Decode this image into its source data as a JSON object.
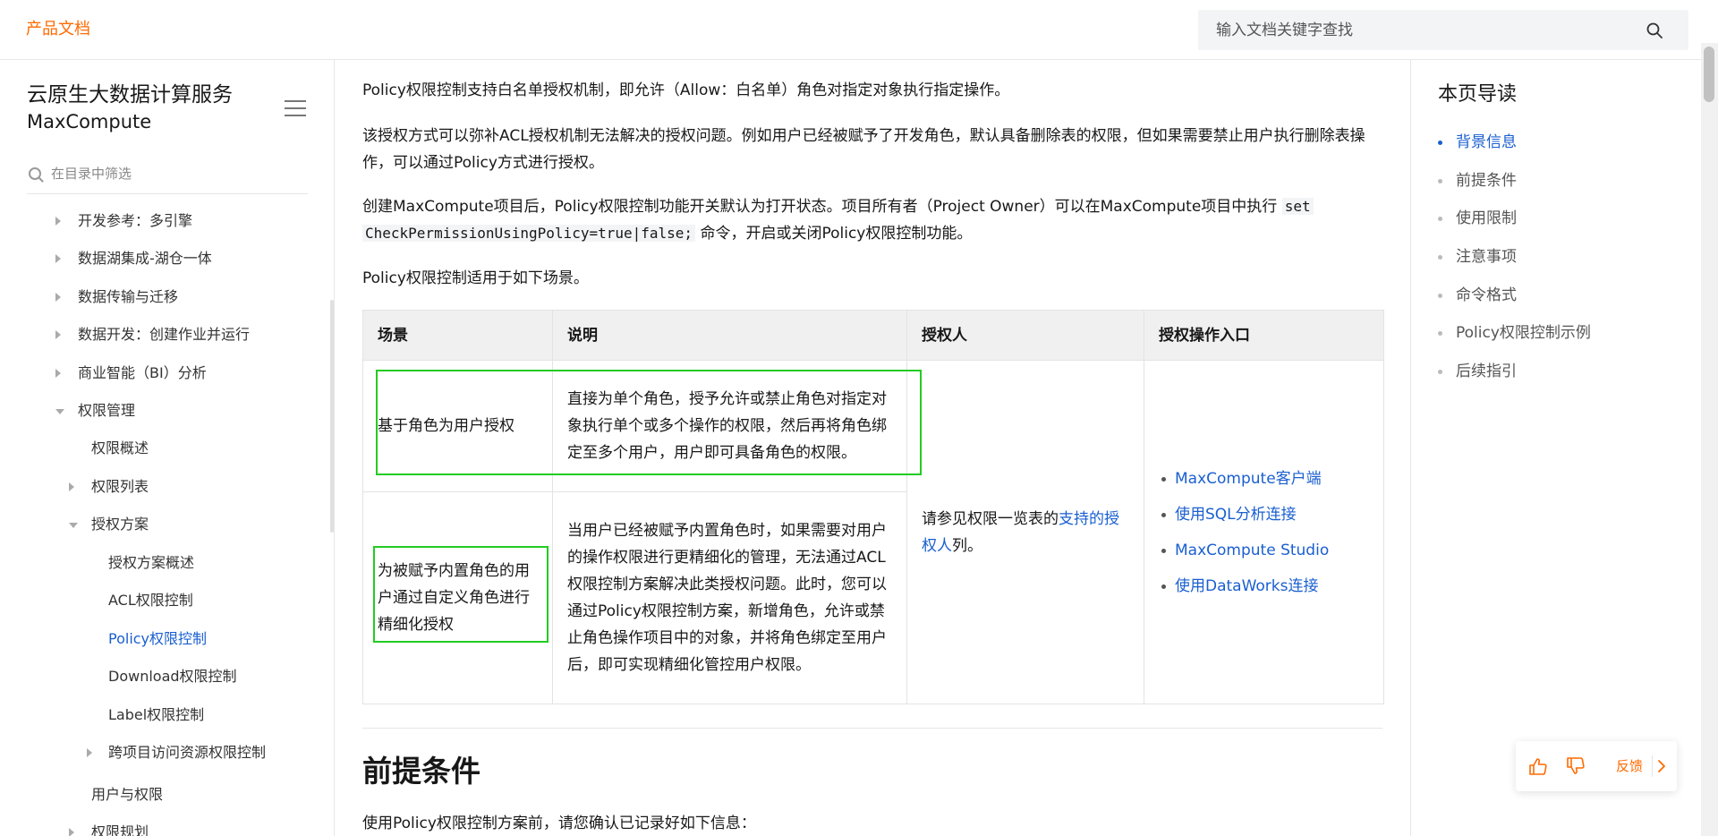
{
  "header": {
    "brand": "产品文档",
    "search_placeholder": "输入文档关键字查找"
  },
  "sidebar": {
    "title": "云原生大数据计算服务",
    "subtitle": "MaxCompute",
    "filter_placeholder": "在目录中筛选",
    "items": [
      {
        "label": "开发参考：多引擎",
        "state": "collapsed"
      },
      {
        "label": "数据湖集成-湖仓一体",
        "state": "collapsed"
      },
      {
        "label": "数据传输与迁移",
        "state": "collapsed"
      },
      {
        "label": "数据开发：创建作业并运行",
        "state": "collapsed"
      },
      {
        "label": "商业智能（BI）分析",
        "state": "collapsed"
      },
      {
        "label": "权限管理",
        "state": "expanded"
      },
      {
        "label": "权限概述",
        "state": "leaf"
      },
      {
        "label": "权限列表",
        "state": "collapsed"
      },
      {
        "label": "授权方案",
        "state": "expanded"
      },
      {
        "label": "授权方案概述",
        "state": "leaf"
      },
      {
        "label": "ACL权限控制",
        "state": "leaf"
      },
      {
        "label": "Policy权限控制",
        "state": "active"
      },
      {
        "label": "Download权限控制",
        "state": "leaf"
      },
      {
        "label": "Label权限控制",
        "state": "leaf"
      },
      {
        "label": "跨项目访问资源权限控制",
        "state": "collapsed"
      },
      {
        "label": "用户与权限",
        "state": "leaf"
      },
      {
        "label": "权限规划",
        "state": "collapsed"
      }
    ]
  },
  "content": {
    "p1": "Policy权限控制支持白名单授权机制，即允许（Allow：白名单）角色对指定对象执行指定操作。",
    "p2": "该授权方式可以弥补ACL授权机制无法解决的授权问题。例如用户已经被赋予了开发角色，默认具备删除表的权限，但如果需要禁止用户执行删除表操作，可以通过Policy方式进行授权。",
    "p3_before": "创建MaxCompute项目后，Policy权限控制功能开关默认为打开状态。项目所有者（Project Owner）可以在MaxCompute项目中执行 ",
    "p3_code1": "set",
    "p3_code2": "CheckPermissionUsingPolicy=true|false;",
    "p3_after": " 命令，开启或关闭Policy权限控制功能。",
    "p4": "Policy权限控制适用于如下场景。",
    "table": {
      "headers": [
        "场景",
        "说明",
        "授权人",
        "授权操作入口"
      ],
      "row1_scene": "基于角色为用户授权",
      "row1_desc": "直接为单个角色，授予允许或禁止角色对指定对象执行单个或多个操作的权限，然后再将角色绑定至多个用户，用户即可具备角色的权限。",
      "row2_scene": "为被赋予内置角色的用户通过自定义角色进行精细化授权",
      "row2_desc": "当用户已经被赋予内置角色时，如果需要对用户的操作权限进行更精细化的管理，无法通过ACL权限控制方案解决此类授权问题。此时，您可以通过Policy权限控制方案，新增角色，允许或禁止角色操作项目中的对象，并将角色绑定至用户后，即可实现精细化管控用户权限。",
      "grantor_prefix": "请参见权限一览表的",
      "grantor_link": "支持的授权人",
      "grantor_suffix": "列。",
      "entries": [
        "MaxCompute客户端",
        "使用SQL分析连接",
        "MaxCompute Studio",
        "使用DataWorks连接"
      ]
    },
    "h2": "前提条件",
    "p5": "使用Policy权限控制方案前，请您确认已记录好如下信息："
  },
  "toc": {
    "title": "本页导读",
    "items": [
      "背景信息",
      "前提条件",
      "使用限制",
      "注意事项",
      "命令格式",
      "Policy权限控制示例",
      "后续指引"
    ]
  },
  "feedback": {
    "label": "反馈"
  },
  "colors": {
    "brand": "#ff6a00",
    "link": "#1a5fd0",
    "highlight_box": "#22cc22"
  }
}
